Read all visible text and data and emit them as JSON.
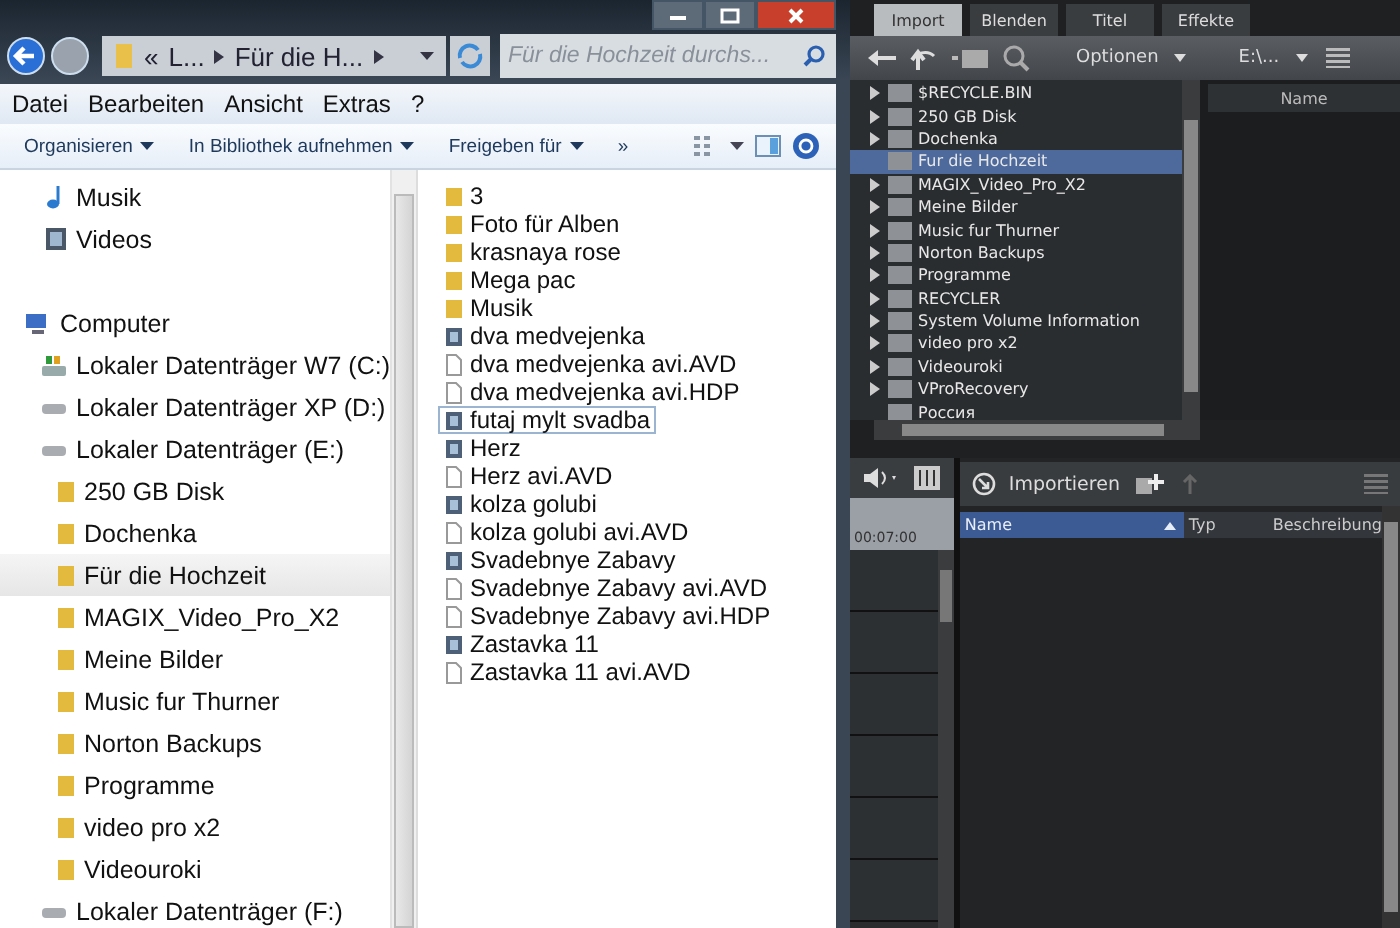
{
  "explorer": {
    "breadcrumb": [
      {
        "label": "«"
      },
      {
        "label": "L..."
      },
      {
        "label": "Für die H..."
      }
    ],
    "search": {
      "placeholder": "Für die Hochzeit durchs..."
    },
    "menu": [
      "Datei",
      "Bearbeiten",
      "Ansicht",
      "Extras",
      "?"
    ],
    "toolbar": [
      {
        "label": "Organisieren",
        "dropdown": true
      },
      {
        "label": "In Bibliothek aufnehmen",
        "dropdown": true
      },
      {
        "label": "Freigeben für",
        "dropdown": true
      },
      {
        "label": "»",
        "dropdown": false
      }
    ],
    "nav_libraries": [
      {
        "label": "Musik",
        "kind": "music"
      },
      {
        "label": "Videos",
        "kind": "video"
      }
    ],
    "nav_tree": [
      {
        "label": "Computer",
        "kind": "computer",
        "selected": false,
        "children": [
          {
            "label": "Lokaler Datenträger W7 (C:)",
            "kind": "system",
            "selected": false
          },
          {
            "label": "Lokaler Datenträger XP (D:)",
            "kind": "drive",
            "selected": false
          },
          {
            "label": "Lokaler Datenträger (E:)",
            "kind": "drive",
            "selected": false,
            "children": [
              {
                "label": "250 GB Disk",
                "kind": "folder",
                "selected": false
              },
              {
                "label": "Dochenka",
                "kind": "folder",
                "selected": false
              },
              {
                "label": "Für die Hochzeit",
                "kind": "folder",
                "selected": true
              },
              {
                "label": "MAGIX_Video_Pro_X2",
                "kind": "folder",
                "selected": false
              },
              {
                "label": "Meine Bilder",
                "kind": "folder",
                "selected": false
              },
              {
                "label": "Music fur Thurner",
                "kind": "folder",
                "selected": false
              },
              {
                "label": "Norton Backups",
                "kind": "folder",
                "selected": false
              },
              {
                "label": "Programme",
                "kind": "folder",
                "selected": false
              },
              {
                "label": "video pro x2",
                "kind": "folder",
                "selected": false
              },
              {
                "label": "Videouroki",
                "kind": "folder",
                "selected": false
              }
            ]
          },
          {
            "label": "Lokaler Datenträger (F:)",
            "kind": "drive",
            "selected": false
          }
        ]
      }
    ],
    "files": [
      {
        "name": "3",
        "kind": "folder",
        "selected": false
      },
      {
        "name": "Foto für Alben",
        "kind": "folder",
        "selected": false
      },
      {
        "name": "krasnaya rose",
        "kind": "folder",
        "selected": false
      },
      {
        "name": "Mega pac",
        "kind": "folder",
        "selected": false
      },
      {
        "name": "Musik",
        "kind": "folder",
        "selected": false
      },
      {
        "name": "dva medvejenka",
        "kind": "video",
        "selected": false
      },
      {
        "name": "dva medvejenka avi.AVD",
        "kind": "file",
        "selected": false
      },
      {
        "name": "dva medvejenka avi.HDP",
        "kind": "file",
        "selected": false
      },
      {
        "name": "futaj mylt svadba",
        "kind": "video",
        "selected": true
      },
      {
        "name": "Herz",
        "kind": "video",
        "selected": false
      },
      {
        "name": "Herz avi.AVD",
        "kind": "file",
        "selected": false
      },
      {
        "name": "kolza golubi",
        "kind": "video",
        "selected": false
      },
      {
        "name": "kolza golubi avi.AVD",
        "kind": "file",
        "selected": false
      },
      {
        "name": "Svadebnye Zabavy",
        "kind": "video",
        "selected": false
      },
      {
        "name": "Svadebnye Zabavy avi.AVD",
        "kind": "file",
        "selected": false
      },
      {
        "name": "Svadebnye Zabavy avi.HDP",
        "kind": "file",
        "selected": false
      },
      {
        "name": "Zastavka 11",
        "kind": "video",
        "selected": false
      },
      {
        "name": "Zastavka 11 avi.AVD",
        "kind": "file",
        "selected": false
      }
    ]
  },
  "editor": {
    "tabs": [
      {
        "label": "Import",
        "selected": true
      },
      {
        "label": "Blenden",
        "selected": false
      },
      {
        "label": "Titel",
        "selected": false
      },
      {
        "label": "Effekte",
        "selected": false
      }
    ],
    "options_label": "Optionen",
    "path_label": "E:\\...",
    "tree": [
      {
        "label": "$RECYCLE.BIN",
        "expandable": true,
        "selected": false
      },
      {
        "label": "250 GB Disk",
        "expandable": true,
        "selected": false
      },
      {
        "label": "Dochenka",
        "expandable": true,
        "selected": false
      },
      {
        "label": "Fur die Hochzeit",
        "expandable": false,
        "selected": true
      },
      {
        "label": "MAGIX_Video_Pro_X2",
        "expandable": true,
        "selected": false
      },
      {
        "label": "Meine Bilder",
        "expandable": true,
        "selected": false
      },
      {
        "label": "Music fur Thurner",
        "expandable": true,
        "selected": false
      },
      {
        "label": "Norton Backups",
        "expandable": true,
        "selected": false
      },
      {
        "label": "Programme",
        "expandable": true,
        "selected": false
      },
      {
        "label": "RECYCLER",
        "expandable": true,
        "selected": false
      },
      {
        "label": "System Volume Information",
        "expandable": true,
        "selected": false
      },
      {
        "label": "video pro x2",
        "expandable": true,
        "selected": false
      },
      {
        "label": "Videouroki",
        "expandable": true,
        "selected": false
      },
      {
        "label": "VProRecovery",
        "expandable": true,
        "selected": false
      },
      {
        "label": "Россия",
        "expandable": false,
        "selected": false
      }
    ],
    "list_header": "Name",
    "timecode": "00:07:00",
    "import_label": "Importieren",
    "columns": [
      {
        "label": "Name",
        "selected": true
      },
      {
        "label": "Typ",
        "selected": false
      },
      {
        "label": "Beschreibung",
        "selected": false
      }
    ]
  }
}
